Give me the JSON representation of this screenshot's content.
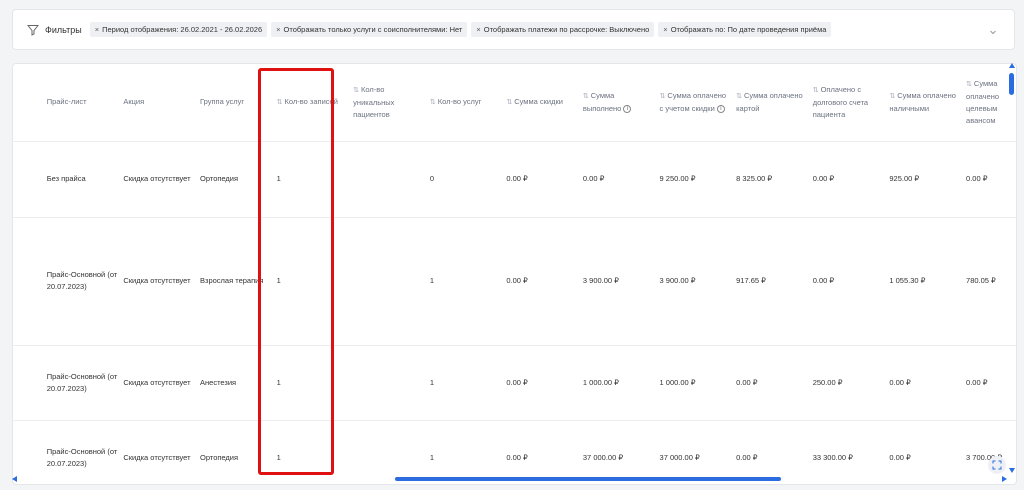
{
  "filters": {
    "label": "Фильтры",
    "icon": "funnel-icon",
    "chips": [
      "Период отображения: 26.02.2021 - 26.02.2026",
      "Отображать только услуги с соисполнителями: Нет",
      "Отображать платежи по рассрочке: Выключено",
      "Отображать по: По дате проведения приёма"
    ],
    "chip_remove_glyph": "×"
  },
  "table": {
    "columns": [
      {
        "label": "Прайс-лист",
        "sortable": false
      },
      {
        "label": "Акция",
        "sortable": false
      },
      {
        "label": "Группа услуг",
        "sortable": false
      },
      {
        "label": "Кол-во записей",
        "sortable": true
      },
      {
        "label": "Кол-во уникальных пациентов",
        "sortable": true
      },
      {
        "label": "Кол-во услуг",
        "sortable": true
      },
      {
        "label": "Сумма скидки",
        "sortable": true
      },
      {
        "label": "Сумма выполнено",
        "sortable": true,
        "info": true
      },
      {
        "label": "Сумма оплачено с учетом скидки",
        "sortable": true,
        "info": true
      },
      {
        "label": "Сумма оплачено картой",
        "sortable": true
      },
      {
        "label": "Оплачено с долгового счета пациента",
        "sortable": true
      },
      {
        "label": "Сумма оплачено наличными",
        "sortable": true
      },
      {
        "label": "Сумма оплачено целевым авансом",
        "sortable": true
      }
    ],
    "sort_glyph": "⇅",
    "info_glyph": "i",
    "rows": [
      [
        "Без прайса",
        "Скидка отсутствует",
        "Ортопедия",
        "1",
        "",
        "0",
        "0.00 ₽",
        "0.00 ₽",
        "9 250.00 ₽",
        "8 325.00 ₽",
        "0.00 ₽",
        "925.00 ₽",
        "0.00 ₽"
      ],
      [
        "Прайс-Основной (от 20.07.2023)",
        "Скидка отсутствует",
        "Взрослая терапия",
        "1",
        "",
        "1",
        "0.00 ₽",
        "3 900.00 ₽",
        "3 900.00 ₽",
        "917.65 ₽",
        "0.00 ₽",
        "1 055.30 ₽",
        "780.05 ₽"
      ],
      [
        "Прайс-Основной (от 20.07.2023)",
        "Скидка отсутствует",
        "Анестезия",
        "1",
        "",
        "1",
        "0.00 ₽",
        "1 000.00 ₽",
        "1 000.00 ₽",
        "0.00 ₽",
        "250.00 ₽",
        "0.00 ₽",
        "0.00 ₽"
      ],
      [
        "Прайс-Основной (от 20.07.2023)",
        "Скидка отсутствует",
        "Ортопедия",
        "1",
        "",
        "1",
        "0.00 ₽",
        "37 000.00 ₽",
        "37 000.00 ₽",
        "0.00 ₽",
        "33 300.00 ₽",
        "0.00 ₽",
        "3 700.00 ₽"
      ]
    ]
  },
  "colors": {
    "highlight": "#e01010",
    "scrollbar": "#2b6de0"
  }
}
